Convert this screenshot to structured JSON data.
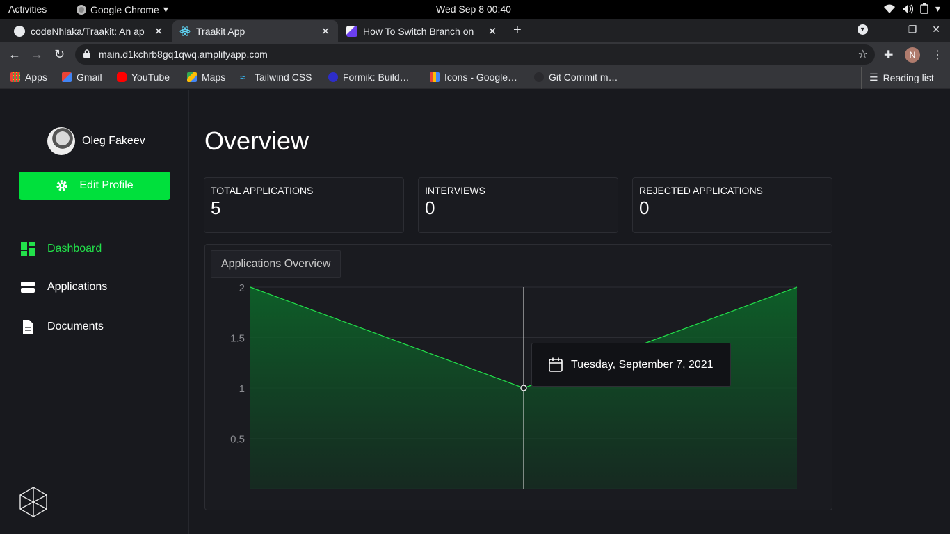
{
  "system": {
    "activities": "Activities",
    "app_name": "Google Chrome",
    "clock": "Wed Sep 8  00:40"
  },
  "tabs": [
    {
      "title": "codeNhlaka/Traakit: An ap",
      "active": false
    },
    {
      "title": "Traakit App",
      "active": true
    },
    {
      "title": "How To Switch Branch on",
      "active": false
    }
  ],
  "address_bar": {
    "url": "main.d1kchrb8gq1qwq.amplifyapp.com"
  },
  "profile_initial": "N",
  "bookmarks": [
    {
      "label": "Apps",
      "icon": "apps-grid-icon"
    },
    {
      "label": "Gmail",
      "icon": "gmail-icon"
    },
    {
      "label": "YouTube",
      "icon": "youtube-icon"
    },
    {
      "label": "Maps",
      "icon": "maps-icon"
    },
    {
      "label": "Tailwind CSS",
      "icon": "tailwind-icon"
    },
    {
      "label": "Formik: Build…",
      "icon": "formik-icon"
    },
    {
      "label": "Icons - Google…",
      "icon": "google-fonts-icon"
    },
    {
      "label": "Git Commit m…",
      "icon": "github-icon"
    }
  ],
  "reading_list": "Reading list",
  "sidebar": {
    "user_name": "Oleg Fakeev",
    "edit_profile": "Edit Profile",
    "nav": [
      {
        "label": "Dashboard",
        "icon": "dashboard-icon",
        "active": true
      },
      {
        "label": "Applications",
        "icon": "applications-icon",
        "active": false
      },
      {
        "label": "Documents",
        "icon": "document-icon",
        "active": false
      }
    ]
  },
  "main": {
    "title": "Overview",
    "stats": [
      {
        "label": "TOTAL APPLICATIONS",
        "value": "5"
      },
      {
        "label": "INTERVIEWS",
        "value": "0"
      },
      {
        "label": "REJECTED APPLICATIONS",
        "value": "0"
      }
    ],
    "chart_tab": "Applications Overview",
    "tooltip_date": "Tuesday, September 7, 2021"
  },
  "colors": {
    "accent": "#00e03c",
    "line": "#22e04a",
    "background": "#18191e"
  },
  "chart_data": {
    "type": "area",
    "x": [
      "",
      "Tuesday, September 7, 2021",
      ""
    ],
    "series": [
      {
        "values": [
          2,
          1,
          2
        ]
      }
    ],
    "ylim": [
      0,
      2
    ],
    "yticks": [
      "2",
      "1.5",
      "1",
      "0.5"
    ],
    "grid": true,
    "highlighted_index": 1
  }
}
